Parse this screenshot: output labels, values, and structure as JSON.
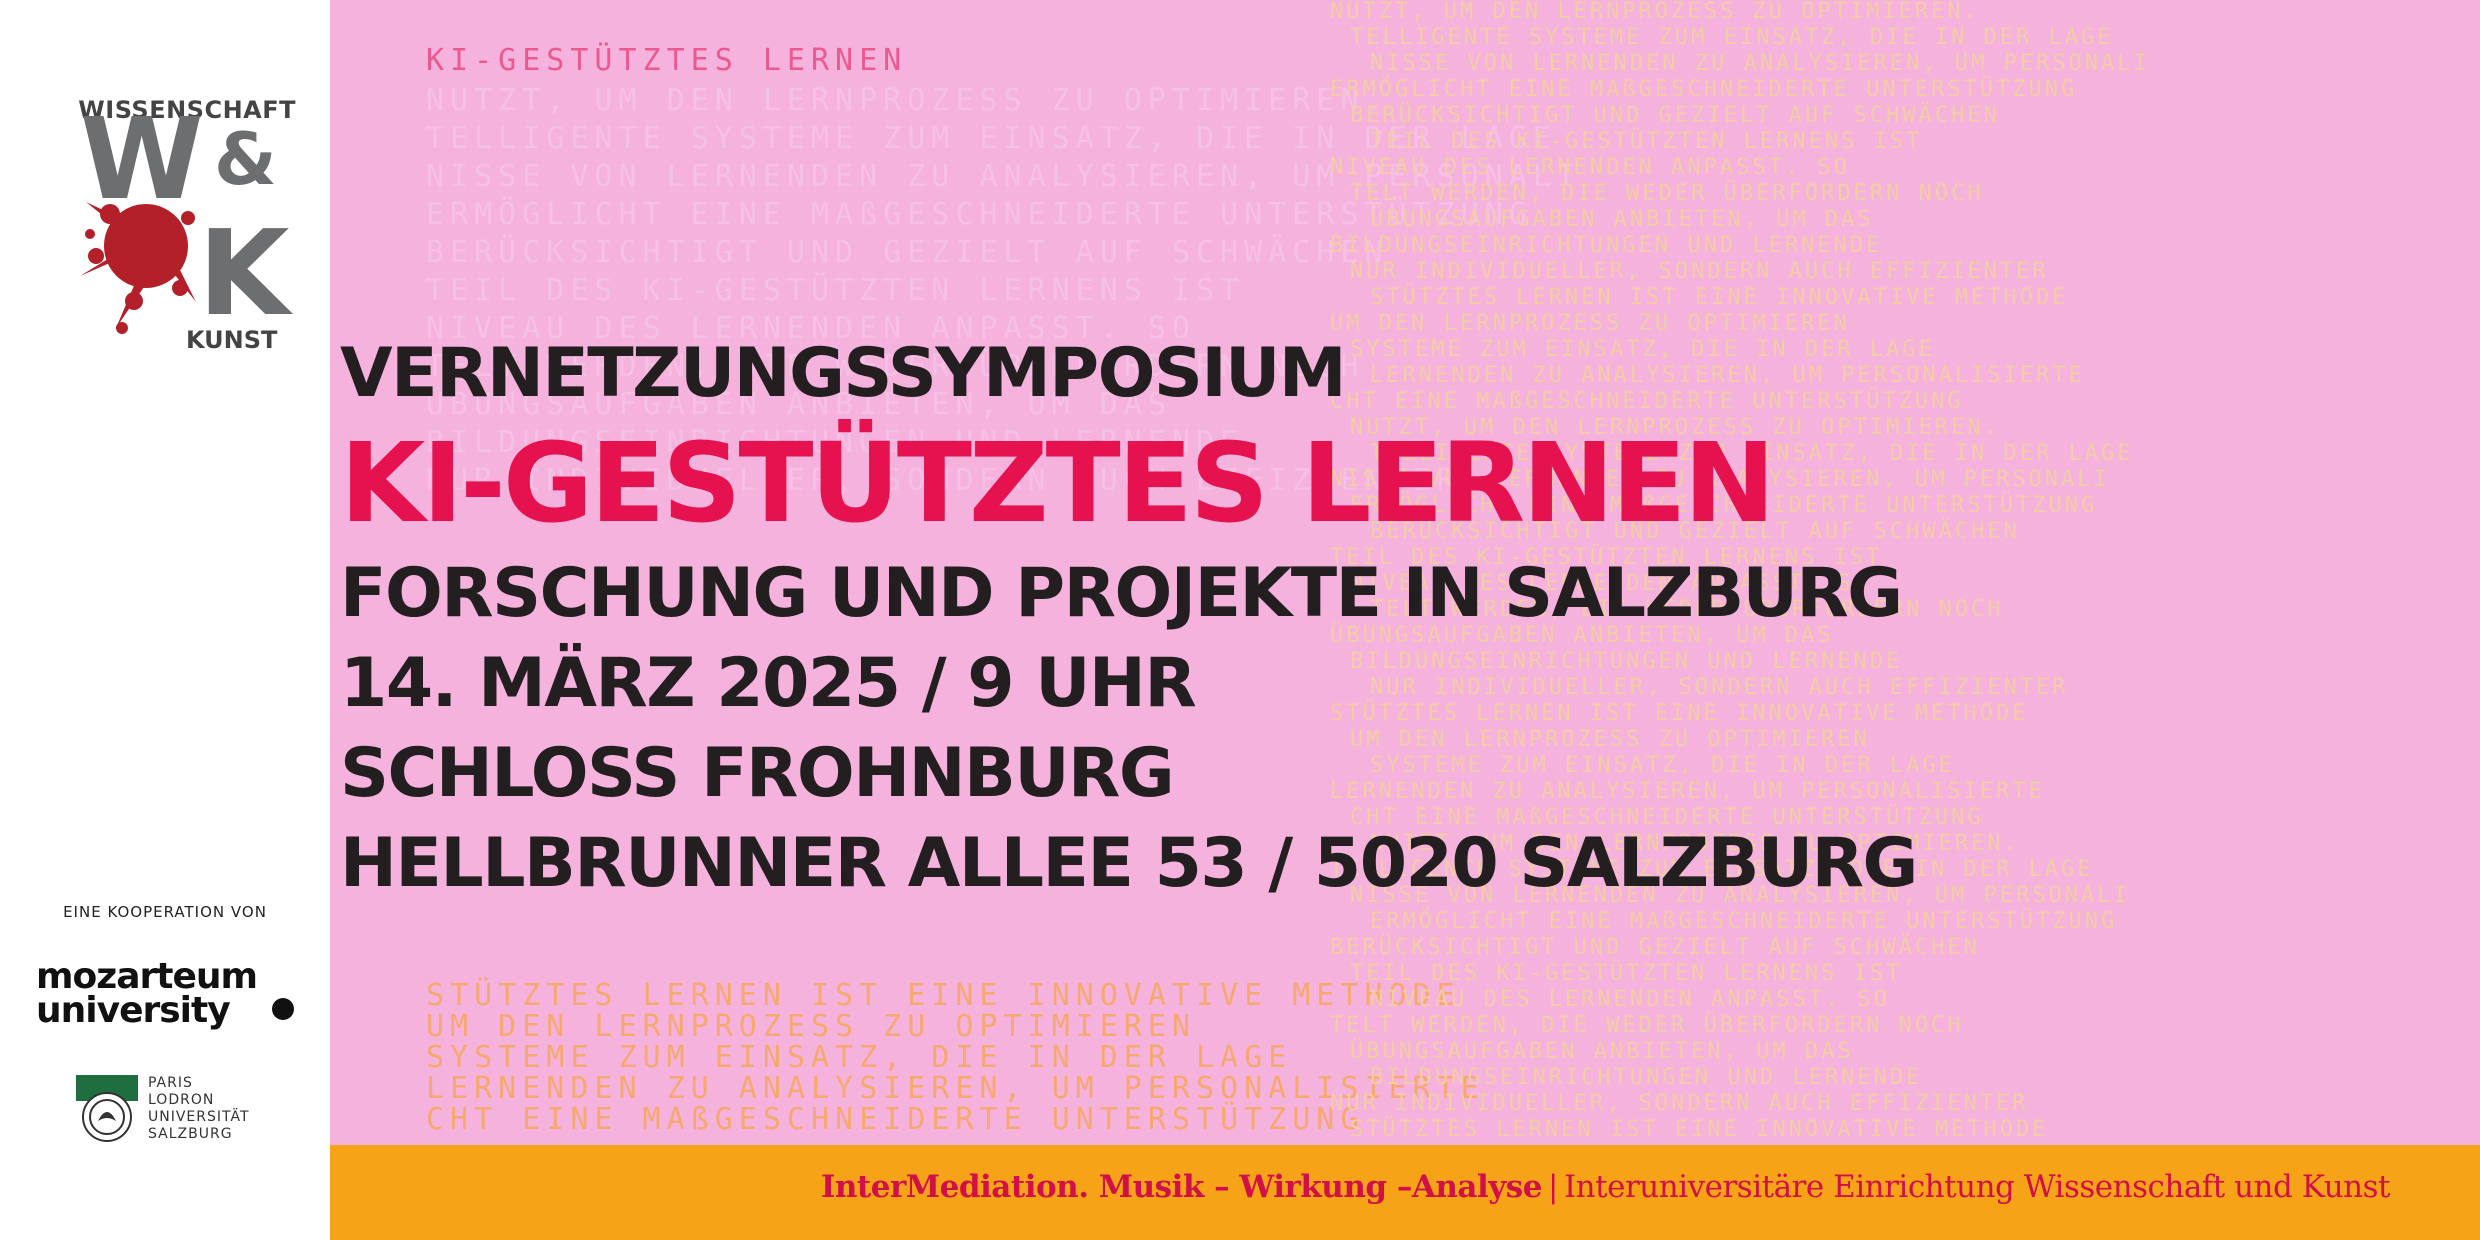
{
  "logo": {
    "top": "WISSENSCHAFT",
    "letters": "W&K",
    "bottom": "KUNST"
  },
  "cooperation_label": "EINE KOOPERATION VON",
  "partners": {
    "mozarteum_line1": "mozarteum",
    "mozarteum_line2": "university",
    "plus_lines": [
      "PARIS",
      "LODRON",
      "UNIVERSITÄT",
      "SALZBURG"
    ]
  },
  "event": {
    "kicker": "VERNETZUNGSSYMPOSIUM",
    "title": "KI-GESTÜTZTES LERNEN",
    "subtitle": "FORSCHUNG UND PROJEKTE IN SALZBURG",
    "date_time": "14. MÄRZ 2025  /  9 UHR",
    "venue": "SCHLOSS FROHNBURG",
    "address": "HELLBRUNNER ALLEE 53 / 5020 SALZBURG"
  },
  "background_text": {
    "heading": "KI-GESTÜTZTES LERNEN",
    "lines": [
      "NUTZT, UM DEN LERNPROZESS ZU OPTIMIEREN.",
      "TELLIGENTE SYSTEME ZUM EINSATZ, DIE IN DER LAGE",
      "NISSE VON LERNENDEN ZU ANALYSIEREN, UM PERSONALI",
      "ERMÖGLICHT EINE MAßGESCHNEIDERTE UNTERSTÜTZUNG",
      "BERÜCKSICHTIGT UND GEZIELT AUF SCHWÄCHEN",
      "TEIL DES KI-GESTÜTZTEN LERNENS IST",
      "NIVEAU DES LERNENDEN ANPASST. SO",
      "TELT WERDEN, DIE WEDER ÜBERFORDERN NOCH",
      "ÜBUNGSAUFGABEN ANBIETEN, UM DAS",
      "BILDUNGSEINRICHTUNGEN UND LERNENDE",
      "NUR INDIVIDUELLER, SONDERN AUCH EFFIZIENTER",
      "STÜTZTES LERNEN IST EINE INNOVATIVE METHODE",
      "UM DEN LERNPROZESS ZU OPTIMIEREN",
      "SYSTEME ZUM EINSATZ, DIE IN DER LAGE",
      "LERNENDEN ZU ANALYSIEREN, UM PERSONALISIERTE",
      "CHT EINE MAßGESCHNEIDERTE UNTERSTÜTZUNG"
    ]
  },
  "footer": {
    "strong": "InterMediation. Musik – Wirkung –Analyse",
    "separator": "|",
    "rest": "Interuniversitäre Einrichtung Wissenschaft und Kunst"
  },
  "colors": {
    "panel": "#f5b2dd",
    "title_accent": "#e5124f",
    "footer_bar": "#f6a317",
    "footer_text": "#d10f48",
    "dark_text": "#231f20",
    "splash": "#b3202a"
  }
}
